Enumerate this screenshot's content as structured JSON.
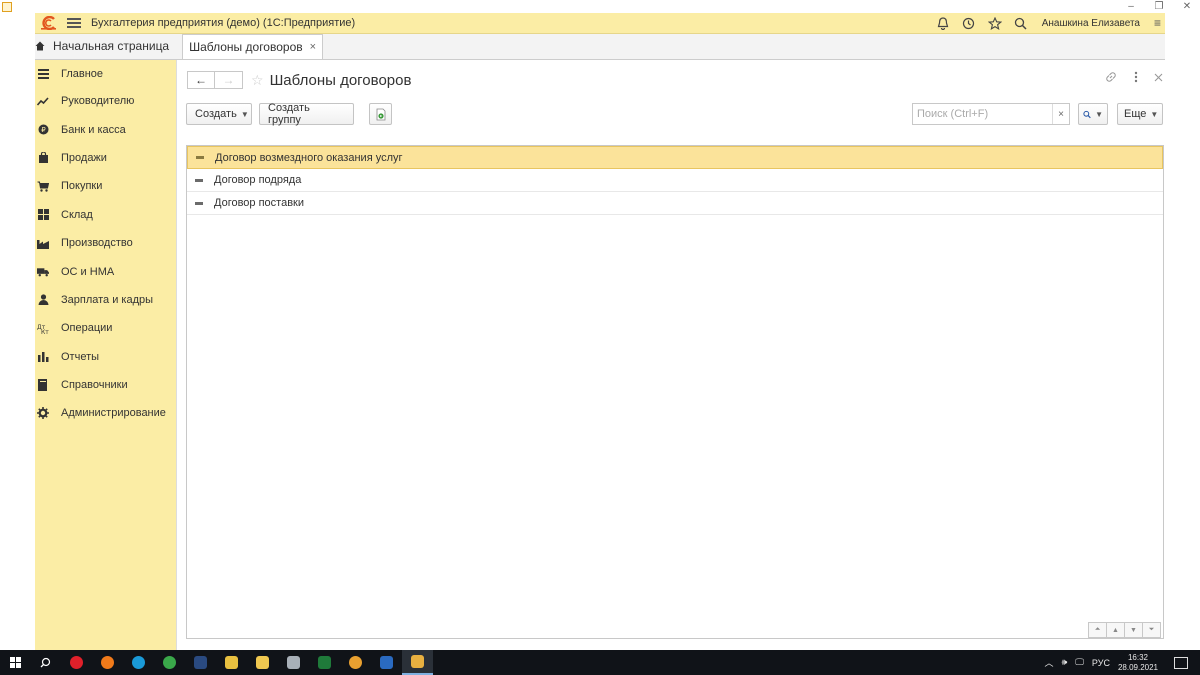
{
  "window": {
    "controls": [
      "–",
      "❐",
      "✕"
    ]
  },
  "titlebar": {
    "app_title": "Бухгалтерия предприятия (демо)  (1С:Предприятие)",
    "user_name": "Анашкина Елизавета",
    "more": "≡"
  },
  "tabs": {
    "home_label": "Начальная страница",
    "active_label": "Шаблоны договоров",
    "close": "×"
  },
  "sidebar": {
    "items": [
      {
        "label": "Главное",
        "icon": "menu-lines-icon"
      },
      {
        "label": "Руководителю",
        "icon": "trend-icon"
      },
      {
        "label": "Банк и касса",
        "icon": "coin-icon"
      },
      {
        "label": "Продажи",
        "icon": "bag-icon"
      },
      {
        "label": "Покупки",
        "icon": "cart-icon"
      },
      {
        "label": "Склад",
        "icon": "warehouse-icon"
      },
      {
        "label": "Производство",
        "icon": "factory-icon"
      },
      {
        "label": "ОС и НМА",
        "icon": "truck-icon"
      },
      {
        "label": "Зарплата и кадры",
        "icon": "person-icon"
      },
      {
        "label": "Операции",
        "icon": "operations-icon"
      },
      {
        "label": "Отчеты",
        "icon": "bar-chart-icon"
      },
      {
        "label": "Справочники",
        "icon": "book-icon"
      },
      {
        "label": "Администрирование",
        "icon": "gear-icon"
      }
    ]
  },
  "form": {
    "title": "Шаблоны договоров",
    "back": "←",
    "forward": "→",
    "star": "☆"
  },
  "toolbar": {
    "create_label": "Создать",
    "create_group_label": "Создать группу",
    "search_placeholder": "Поиск (Ctrl+F)",
    "search_clear": "×",
    "more_label": "Еще"
  },
  "list": {
    "rows": [
      {
        "label": "Договор возмездного оказания услуг",
        "selected": true
      },
      {
        "label": "Договор подряда",
        "selected": false
      },
      {
        "label": "Договор поставки",
        "selected": false
      }
    ]
  },
  "taskbar": {
    "language": "РУС",
    "time": "16:32",
    "date": "28.09.2021"
  },
  "colors": {
    "accent_yellow": "#fbeda5",
    "selected_row": "#fbe39a",
    "logo_orange": "#e2561f"
  }
}
